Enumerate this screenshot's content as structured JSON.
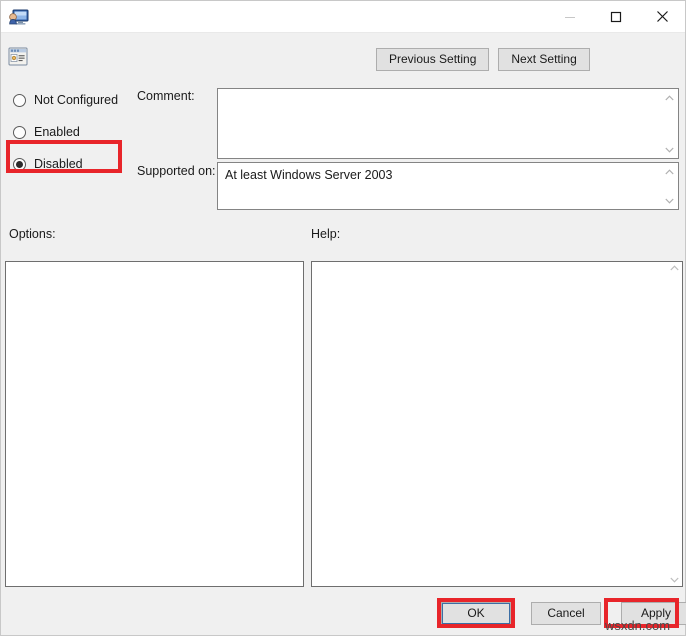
{
  "window": {
    "title": "",
    "icon": "policy-computer-icon",
    "controls": {
      "minimize": "minimize-icon",
      "maximize": "maximize-icon",
      "close": "close-icon"
    }
  },
  "toolbar": {
    "setting_icon": "group-policy-setting-icon",
    "previous_setting_label": "Previous Setting",
    "next_setting_label": "Next Setting"
  },
  "states": {
    "options": [
      {
        "label": "Not Configured",
        "selected": false
      },
      {
        "label": "Enabled",
        "selected": false
      },
      {
        "label": "Disabled",
        "selected": true
      }
    ]
  },
  "comment": {
    "label": "Comment:",
    "value": "",
    "placeholder": ""
  },
  "supported_on": {
    "label": "Supported on:",
    "value": "At least Windows Server 2003"
  },
  "options_panel": {
    "label": "Options:",
    "value": ""
  },
  "help_panel": {
    "label": "Help:",
    "value": ""
  },
  "footer": {
    "ok_label": "OK",
    "cancel_label": "Cancel",
    "apply_label": "Apply"
  },
  "annotations": {
    "highlight_color": "#e8252a",
    "highlighted": [
      "Disabled",
      "OK",
      "Apply"
    ]
  },
  "watermark": {
    "text": "wsxdn.com"
  }
}
